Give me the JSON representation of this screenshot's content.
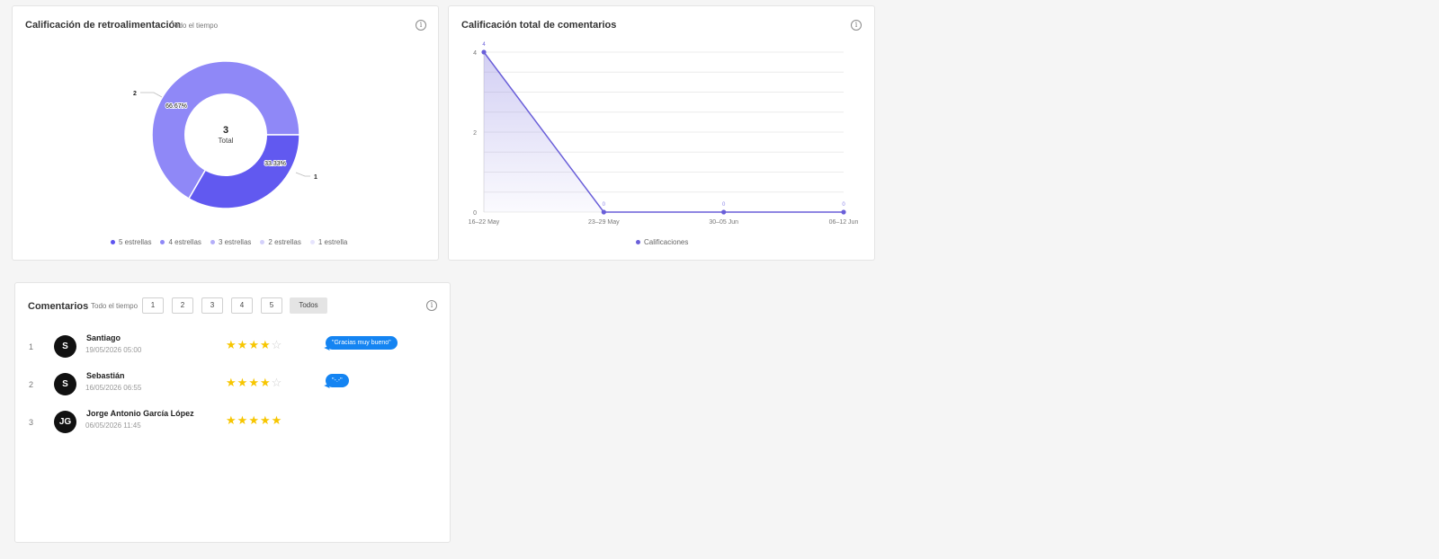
{
  "donut_card": {
    "title": "Calificación de retroalimentación",
    "subtitle": "Todo el tiempo",
    "info_icon": "i",
    "center_value": "3",
    "center_label": "Total",
    "slice_labels": [
      "66.67%",
      "33.33%"
    ],
    "callouts": [
      "2",
      "1"
    ],
    "legend": [
      {
        "label": "5 estrellas",
        "color": "#5e54f0"
      },
      {
        "label": "4 estrellas",
        "color": "#8f88f7"
      },
      {
        "label": "3 estrellas",
        "color": "#b4aef9"
      },
      {
        "label": "2 estrellas",
        "color": "#d4d1fb"
      },
      {
        "label": "1 estrella",
        "color": "#e6e4fd"
      }
    ]
  },
  "chart_data": {
    "type": "area",
    "title": "Calificación total de comentarios",
    "categories": [
      "16–22 May",
      "23–29 May",
      "30–05 Jun",
      "06–12 Jun"
    ],
    "series": [
      {
        "name": "Calificaciones",
        "values": [
          4,
          0,
          0,
          0
        ]
      }
    ],
    "data_labels": [
      "4",
      "0",
      "0",
      "0"
    ],
    "yticks": [
      "0",
      "2",
      "4"
    ],
    "ylim": [
      0,
      4
    ],
    "grid": true,
    "legend_position": "bottom",
    "color": "#6a5fd9",
    "donut": {
      "type": "pie",
      "categories": [
        "4 estrellas",
        "5 estrellas"
      ],
      "values": [
        2,
        1
      ],
      "percent_labels": [
        "66.67%",
        "33.33%"
      ],
      "colors": [
        "#8f88f7",
        "#6159f0"
      ]
    }
  },
  "line_card": {
    "title": "Calificación total de comentarios",
    "info_icon": "i",
    "legend_label": "Calificaciones",
    "legend_color": "#6a5fd9"
  },
  "comments": {
    "title": "Comentarios",
    "subtitle": "Todo el tiempo",
    "info_icon": "i",
    "filters": [
      "1",
      "2",
      "3",
      "4",
      "5"
    ],
    "filter_all": "Todos",
    "rows": [
      {
        "num": "1",
        "initials": "S",
        "name": "Santiago",
        "date": "19/05/2026 05:00",
        "rating": 4,
        "comment": "\"Gracias muy bueno\""
      },
      {
        "num": "2",
        "initials": "S",
        "name": "Sebastián",
        "date": "16/05/2026 06:55",
        "rating": 4,
        "comment": "\"-.-\""
      },
      {
        "num": "3",
        "initials": "JG",
        "name": "Jorge Antonio García López",
        "date": "06/05/2026 11:45",
        "rating": 5,
        "comment": ""
      }
    ],
    "star_on_color": "#f7c600",
    "star_off_color": "#cfcfcf",
    "bubble_color": "#1484f2"
  }
}
